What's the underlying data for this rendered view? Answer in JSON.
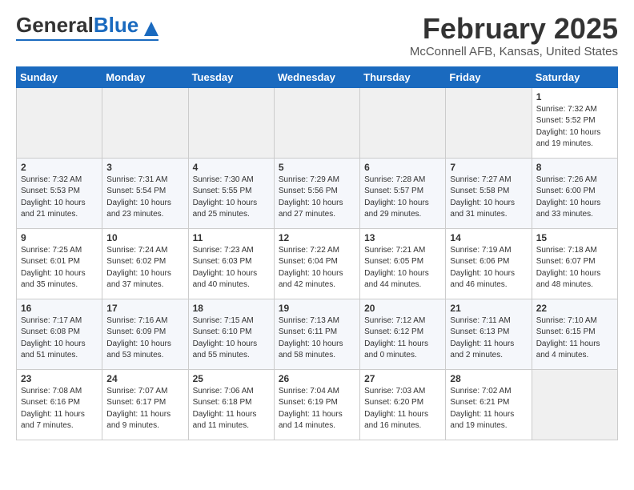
{
  "header": {
    "logo_general": "General",
    "logo_blue": "Blue",
    "title": "February 2025",
    "location": "McConnell AFB, Kansas, United States"
  },
  "days_of_week": [
    "Sunday",
    "Monday",
    "Tuesday",
    "Wednesday",
    "Thursday",
    "Friday",
    "Saturday"
  ],
  "weeks": [
    [
      {
        "day": "",
        "info": ""
      },
      {
        "day": "",
        "info": ""
      },
      {
        "day": "",
        "info": ""
      },
      {
        "day": "",
        "info": ""
      },
      {
        "day": "",
        "info": ""
      },
      {
        "day": "",
        "info": ""
      },
      {
        "day": "1",
        "info": "Sunrise: 7:32 AM\nSunset: 5:52 PM\nDaylight: 10 hours\nand 19 minutes."
      }
    ],
    [
      {
        "day": "2",
        "info": "Sunrise: 7:32 AM\nSunset: 5:53 PM\nDaylight: 10 hours\nand 21 minutes."
      },
      {
        "day": "3",
        "info": "Sunrise: 7:31 AM\nSunset: 5:54 PM\nDaylight: 10 hours\nand 23 minutes."
      },
      {
        "day": "4",
        "info": "Sunrise: 7:30 AM\nSunset: 5:55 PM\nDaylight: 10 hours\nand 25 minutes."
      },
      {
        "day": "5",
        "info": "Sunrise: 7:29 AM\nSunset: 5:56 PM\nDaylight: 10 hours\nand 27 minutes."
      },
      {
        "day": "6",
        "info": "Sunrise: 7:28 AM\nSunset: 5:57 PM\nDaylight: 10 hours\nand 29 minutes."
      },
      {
        "day": "7",
        "info": "Sunrise: 7:27 AM\nSunset: 5:58 PM\nDaylight: 10 hours\nand 31 minutes."
      },
      {
        "day": "8",
        "info": "Sunrise: 7:26 AM\nSunset: 6:00 PM\nDaylight: 10 hours\nand 33 minutes."
      }
    ],
    [
      {
        "day": "9",
        "info": "Sunrise: 7:25 AM\nSunset: 6:01 PM\nDaylight: 10 hours\nand 35 minutes."
      },
      {
        "day": "10",
        "info": "Sunrise: 7:24 AM\nSunset: 6:02 PM\nDaylight: 10 hours\nand 37 minutes."
      },
      {
        "day": "11",
        "info": "Sunrise: 7:23 AM\nSunset: 6:03 PM\nDaylight: 10 hours\nand 40 minutes."
      },
      {
        "day": "12",
        "info": "Sunrise: 7:22 AM\nSunset: 6:04 PM\nDaylight: 10 hours\nand 42 minutes."
      },
      {
        "day": "13",
        "info": "Sunrise: 7:21 AM\nSunset: 6:05 PM\nDaylight: 10 hours\nand 44 minutes."
      },
      {
        "day": "14",
        "info": "Sunrise: 7:19 AM\nSunset: 6:06 PM\nDaylight: 10 hours\nand 46 minutes."
      },
      {
        "day": "15",
        "info": "Sunrise: 7:18 AM\nSunset: 6:07 PM\nDaylight: 10 hours\nand 48 minutes."
      }
    ],
    [
      {
        "day": "16",
        "info": "Sunrise: 7:17 AM\nSunset: 6:08 PM\nDaylight: 10 hours\nand 51 minutes."
      },
      {
        "day": "17",
        "info": "Sunrise: 7:16 AM\nSunset: 6:09 PM\nDaylight: 10 hours\nand 53 minutes."
      },
      {
        "day": "18",
        "info": "Sunrise: 7:15 AM\nSunset: 6:10 PM\nDaylight: 10 hours\nand 55 minutes."
      },
      {
        "day": "19",
        "info": "Sunrise: 7:13 AM\nSunset: 6:11 PM\nDaylight: 10 hours\nand 58 minutes."
      },
      {
        "day": "20",
        "info": "Sunrise: 7:12 AM\nSunset: 6:12 PM\nDaylight: 11 hours\nand 0 minutes."
      },
      {
        "day": "21",
        "info": "Sunrise: 7:11 AM\nSunset: 6:13 PM\nDaylight: 11 hours\nand 2 minutes."
      },
      {
        "day": "22",
        "info": "Sunrise: 7:10 AM\nSunset: 6:15 PM\nDaylight: 11 hours\nand 4 minutes."
      }
    ],
    [
      {
        "day": "23",
        "info": "Sunrise: 7:08 AM\nSunset: 6:16 PM\nDaylight: 11 hours\nand 7 minutes."
      },
      {
        "day": "24",
        "info": "Sunrise: 7:07 AM\nSunset: 6:17 PM\nDaylight: 11 hours\nand 9 minutes."
      },
      {
        "day": "25",
        "info": "Sunrise: 7:06 AM\nSunset: 6:18 PM\nDaylight: 11 hours\nand 11 minutes."
      },
      {
        "day": "26",
        "info": "Sunrise: 7:04 AM\nSunset: 6:19 PM\nDaylight: 11 hours\nand 14 minutes."
      },
      {
        "day": "27",
        "info": "Sunrise: 7:03 AM\nSunset: 6:20 PM\nDaylight: 11 hours\nand 16 minutes."
      },
      {
        "day": "28",
        "info": "Sunrise: 7:02 AM\nSunset: 6:21 PM\nDaylight: 11 hours\nand 19 minutes."
      },
      {
        "day": "",
        "info": ""
      }
    ]
  ]
}
